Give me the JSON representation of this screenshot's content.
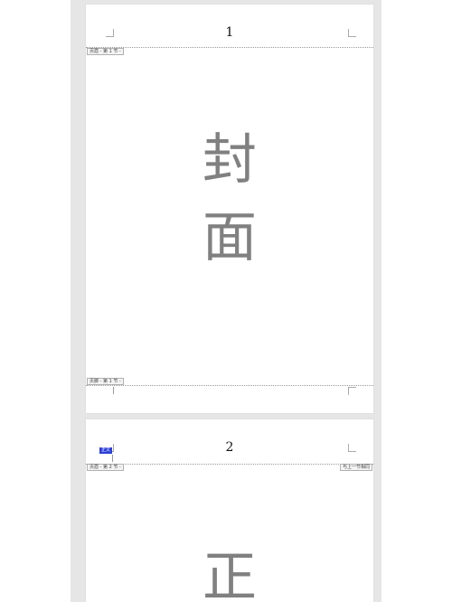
{
  "pages": [
    {
      "page_number": "1",
      "header_tag": "页眉 - 第 1 节 -",
      "footer_tag": "页脚 - 第 1 节 -",
      "content": [
        "封",
        "面"
      ]
    },
    {
      "page_number": "2",
      "header_tag": "页眉 - 第 2 节 -",
      "link_tag": "与上一节相同",
      "badge": "正文",
      "content": [
        "正"
      ]
    }
  ]
}
